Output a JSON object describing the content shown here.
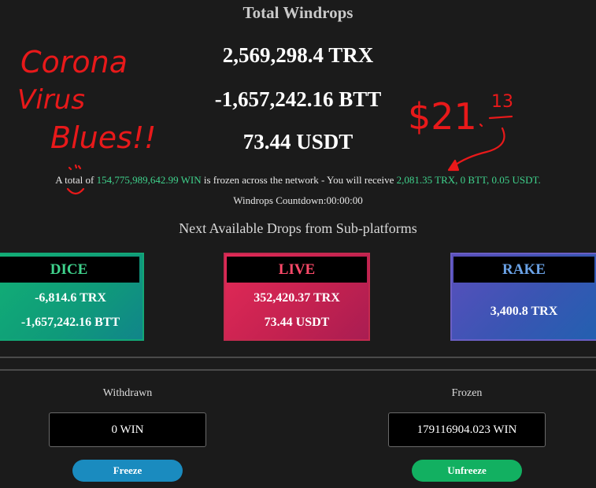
{
  "header": {
    "title": "Total Windrops",
    "totals": [
      "2,569,298.4 TRX",
      "-1,657,242.16 BTT",
      "73.44 USDT"
    ]
  },
  "info": {
    "prefix": "A total of ",
    "win_amount": "154,775,989,642.99 WIN",
    "middle": " is frozen across the network - You will receive ",
    "receive": "2,081.35 TRX, 0 BTT, 0.05 USDT."
  },
  "countdown": "Windrops Countdown:00:00:00",
  "subplatforms": {
    "heading": "Next Available Drops from Sub-platforms",
    "cards": [
      {
        "name": "DICE",
        "values": [
          "-6,814.6 TRX",
          "-1,657,242.16 BTT"
        ]
      },
      {
        "name": "LIVE",
        "values": [
          "352,420.37 TRX",
          "73.44 USDT"
        ]
      },
      {
        "name": "RAKE",
        "values": [
          "3,400.8 TRX"
        ]
      }
    ]
  },
  "wallet": {
    "withdrawn_label": "Withdrawn",
    "withdrawn_value": "0 WIN",
    "frozen_label": "Frozen",
    "frozen_value": "179116904.023 WIN",
    "freeze_label": "Freeze",
    "unfreeze_label": "Unfreeze"
  },
  "annotation": {
    "note_line1": "Corona",
    "note_line2": "Virus",
    "note_line3": "Blues!!",
    "dollar": "$21",
    "cents": "13"
  },
  "colors": {
    "background": "#1b1b1b",
    "dice": "#12b075",
    "live": "#e42a57",
    "rake": "#3a55b3",
    "annotation": "#e8191a",
    "highlight": "#3fd28c"
  }
}
